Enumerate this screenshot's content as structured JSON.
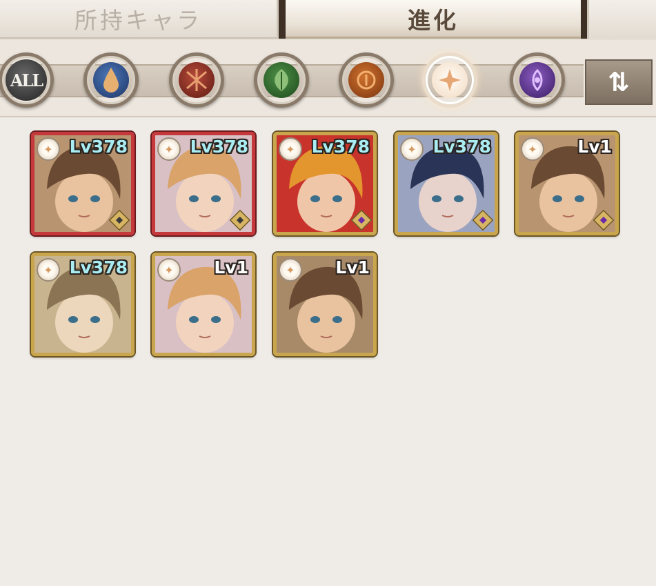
{
  "tabs": [
    {
      "label": "所持キャラ",
      "active": false
    },
    {
      "label": "進化",
      "active": true
    }
  ],
  "filters": [
    {
      "id": "all",
      "label": "ALL",
      "icon": "all-icon"
    },
    {
      "id": "water",
      "icon": "water-drop-icon",
      "color": "#2f5596"
    },
    {
      "id": "fire",
      "icon": "fire-emblem-icon",
      "color": "#9a2f24"
    },
    {
      "id": "wood",
      "icon": "leaf-icon",
      "color": "#3a7434"
    },
    {
      "id": "flame",
      "icon": "flame-emblem-icon",
      "color": "#b85a20"
    },
    {
      "id": "light",
      "icon": "light-star-icon",
      "color": "#f2d9bf",
      "selected": true
    },
    {
      "id": "dark",
      "icon": "dark-eye-icon",
      "color": "#6a3c9a"
    }
  ],
  "sort_button": {
    "icon": "sort-arrows-icon",
    "label": "⇅"
  },
  "characters": [
    {
      "level": "Lv378",
      "frame": "red",
      "gem": "gray",
      "hair": "#6a4a32",
      "skin": "#e9c2a0",
      "bg": "#b89470"
    },
    {
      "level": "Lv378",
      "frame": "red",
      "gem": "gray",
      "hair": "#d9a36a",
      "skin": "#f2d3bd",
      "bg": "#d8c0c4"
    },
    {
      "level": "Lv378",
      "frame": "gold",
      "gem": "purple",
      "hair": "#e3962e",
      "skin": "#f0c6a8",
      "bg": "#c8342c"
    },
    {
      "level": "Lv378",
      "frame": "gold",
      "gem": "purple",
      "hair": "#2a3456",
      "skin": "#e8d2cc",
      "bg": "#9aa4c0"
    },
    {
      "level": "Lv1",
      "frame": "gold",
      "gem": "purple",
      "hair": "#6a4a32",
      "skin": "#e9c2a0",
      "bg": "#b89470"
    },
    {
      "level": "Lv378",
      "frame": "gold",
      "gem": "none",
      "hair": "#8a7454",
      "skin": "#ecd6bc",
      "bg": "#c8b48e"
    },
    {
      "level": "Lv1",
      "frame": "gold",
      "gem": "none",
      "hair": "#d9a36a",
      "skin": "#f2d3bd",
      "bg": "#d8c0c4"
    },
    {
      "level": "Lv1",
      "frame": "gold",
      "gem": "none",
      "hair": "#6a4a32",
      "skin": "#e9c2a0",
      "bg": "#a88a68"
    }
  ],
  "element_badge_icon": "light-star-icon"
}
